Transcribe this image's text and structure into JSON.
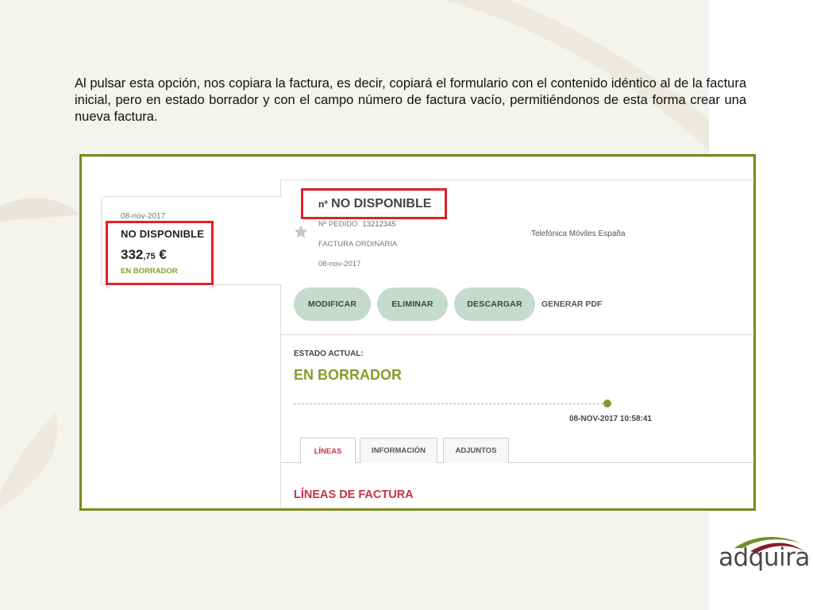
{
  "intro_text": "Al pulsar esta opción, nos copiara la factura, es decir, copiará el formulario con el contenido idéntico al de la factura inicial, pero en estado borrador y con el campo número de factura vacío, permitiéndonos de esta forma crear una nueva factura.",
  "invoice_card": {
    "date": "08-nov-2017",
    "number": "NO DISPONIBLE",
    "amount_int": "332",
    "amount_dec": ",75",
    "currency": "€",
    "status": "EN BORRADOR"
  },
  "invoice_detail": {
    "number_label": "nº",
    "number_value": "NO DISPONIBLE",
    "order_label": "Nº PEDIDO",
    "order_value": "13212345",
    "type": "FACTURA ORDINARIA",
    "date": "08-nov-2017",
    "supplier": "Telefónica Móviles España",
    "star_icon": "star-icon"
  },
  "actions": {
    "modify": "MODIFICAR",
    "delete": "ELIMINAR",
    "download": "DESCARGAR",
    "generate_pdf": "GENERAR PDF"
  },
  "state": {
    "label": "ESTADO ACTUAL:",
    "value": "EN BORRADOR",
    "timestamp": "08-NOV-2017 10:58:41"
  },
  "tabs": [
    {
      "label": "LÍNEAS",
      "active": true
    },
    {
      "label": "INFORMACIÓN",
      "active": false
    },
    {
      "label": "ADJUNTOS",
      "active": false
    }
  ],
  "section_title": "LÍNEAS DE FACTURA",
  "logo": {
    "text": "adquira"
  },
  "colors": {
    "frame": "#7a8a1c",
    "highlight": "#e0202a",
    "accent_green": "#8a9a2a",
    "button_bg": "#c5dbcd",
    "accent_red": "#c8304a"
  }
}
